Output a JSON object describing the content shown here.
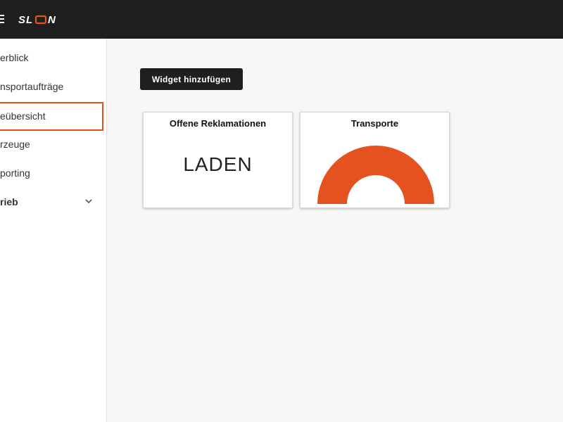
{
  "header": {
    "logo_text": "SLON",
    "brand_color": "#e3521f"
  },
  "sidebar": {
    "items": [
      {
        "label": "erblick"
      },
      {
        "label": "nsportaufträge"
      },
      {
        "label": "eübersicht"
      },
      {
        "label": "rzeuge"
      },
      {
        "label": "porting"
      },
      {
        "label": "rieb"
      }
    ]
  },
  "toolbar": {
    "add_widget_label": "Widget hinzufügen"
  },
  "widgets": [
    {
      "title": "Offene Reklamationen",
      "value": "LADEN"
    },
    {
      "title": "Transporte",
      "gauge_color": "#e3521f"
    }
  ]
}
